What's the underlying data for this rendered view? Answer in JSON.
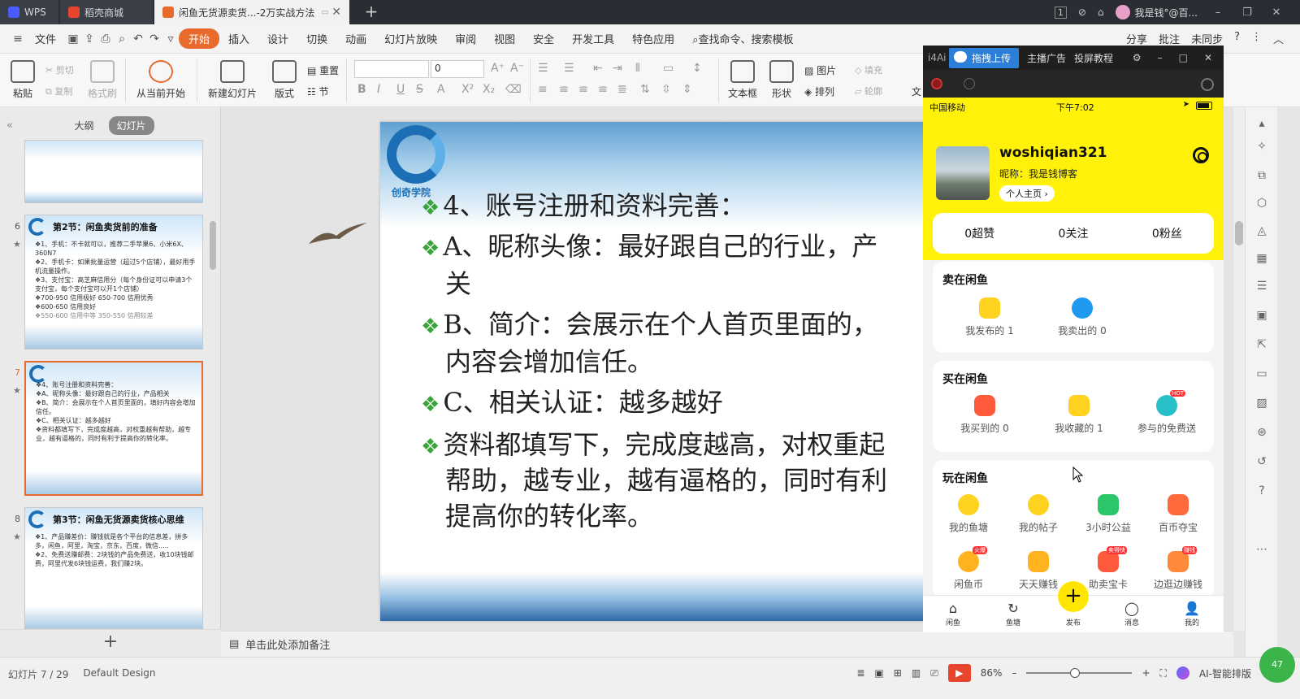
{
  "titlebar": {
    "tabs": [
      {
        "label": "WPS"
      },
      {
        "label": "稻壳商城"
      },
      {
        "label": "闲鱼无货源卖货...-2万实战方法"
      }
    ],
    "badge": "1",
    "user": "我是钱°@百..."
  },
  "menubar": {
    "file": "文件",
    "items": [
      "开始",
      "插入",
      "设计",
      "切换",
      "动画",
      "幻灯片放映",
      "审阅",
      "视图",
      "安全",
      "开发工具",
      "特色应用"
    ],
    "search": "查找命令、搜索模板",
    "right": [
      "分享",
      "批注",
      "未同步"
    ]
  },
  "ribbon": {
    "paste": "粘贴",
    "cut": "剪切",
    "copy": "复制",
    "format_painter": "格式刷",
    "from_start": "从当前开始",
    "new_slide": "新建幻灯片",
    "layout": "版式",
    "reset": "重置",
    "section": "节",
    "font_size": "0",
    "textbox": "文本框",
    "shape": "形状",
    "picture": "图片",
    "arrange": "排列",
    "fill": "填充",
    "outline": "轮廓",
    "text_cut": "文"
  },
  "leftpanel": {
    "tab_outline": "大纲",
    "tab_slides": "幻灯片",
    "slides": [
      {
        "num": "6",
        "title": "第2节：闲鱼卖货前的准备",
        "lines": [
          "❖1、手机：不卡就可以，推荐二手苹果6、小米6X、360N7",
          "❖2、手机卡：如果批量运营（超过5个店铺），最好用手机流量操作。",
          "❖3、支付宝：高芝麻信用分（每个身份证可以申请3个支付宝，每个支付宝可以开1个店铺）",
          "❖700-950 信用极好   650-700 信用优秀",
          "❖600-650 信用良好",
          "❖550-600 信用中等   350-550 信用较差"
        ]
      },
      {
        "num": "7",
        "title": "",
        "lines": [
          "❖4、账号注册和资料完善：",
          "❖A、昵称头像：最好跟自己的行业，产品相关",
          "❖B、简介：会展示在个人首页里面的，填好内容会增加信任。",
          "❖C、相关认证：越多越好",
          "❖资料都填写下，完成度越高，对权重越有帮助，越专业，越有逼格的，同时有利于提高你的转化率。"
        ]
      },
      {
        "num": "8",
        "title": "第3节：闲鱼无货源卖货核心思维",
        "lines": [
          "❖1、产品赚差价：赚钱就是各个平台的信息差，拼多多，闲鱼，阿里，淘宝，京东，百度，微信.....",
          "❖2、免费送赚邮费：2块钱的产品免费送，收10块钱邮费，阿里代发6块钱运费，我们赚2块。"
        ]
      }
    ]
  },
  "slide": {
    "logo_text": "创奇学院",
    "lines": [
      "4、账号注册和资料完善：",
      "A、昵称头像：最好跟自己的行业，产",
      "关",
      "B、简介：会展示在个人首页里面的，",
      "内容会增加信任。",
      "C、相关认证：越多越好",
      "资料都填写下，完成度越高，对权重起",
      "帮助，越专业，越有逼格的，同时有利",
      "提高你的转化率。"
    ]
  },
  "notes": "单击此处添加备注",
  "statusbar": {
    "slide_info": "幻灯片 7 / 29",
    "design": "Default Design",
    "zoom": "86%",
    "ai": "AI-智能排版",
    "ball": "47"
  },
  "phonewin": {
    "brand": "i4Ai",
    "upload": "拖拽上传",
    "link1": "主播广告",
    "link2": "投屏教程"
  },
  "phone": {
    "carrier": "中国移动",
    "time": "下午7:02",
    "username": "woshiqian321",
    "nickname": "昵称：我是钱博客",
    "home_btn": "个人主页 ›",
    "stats": [
      "0超赞",
      "0关注",
      "0粉丝"
    ],
    "sell": {
      "title": "卖在闲鱼",
      "items": [
        "我发布的 1",
        "我卖出的 0"
      ]
    },
    "buy": {
      "title": "买在闲鱼",
      "items": [
        "我买到的 0",
        "我收藏的 1",
        "参与的免费送"
      ]
    },
    "play": {
      "title": "玩在闲鱼",
      "items": [
        "我的鱼塘",
        "我的帖子",
        "3小时公益",
        "百币夺宝",
        "闲鱼币",
        "天天赚钱",
        "助卖宝卡",
        "边逛边赚钱"
      ]
    },
    "tabs": [
      "闲鱼",
      "鱼塘",
      "发布",
      "消息",
      "我的"
    ]
  },
  "colors": {
    "accent": "#e86a2c",
    "xianyu_yellow": "#fff10a",
    "bullet_green": "#3aa53a"
  }
}
